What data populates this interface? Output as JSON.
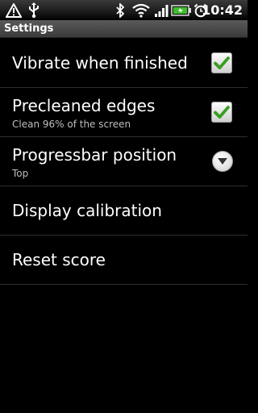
{
  "status_bar": {
    "time": "10:42",
    "icons": [
      "warning-icon",
      "usb-icon",
      "bluetooth-icon",
      "wifi-icon",
      "signal-icon",
      "battery-icon",
      "alarm-icon"
    ]
  },
  "title_bar": {
    "title": "Settings"
  },
  "settings": [
    {
      "title": "Vibrate when finished",
      "control": "checkbox",
      "checked": true
    },
    {
      "title": "Precleaned edges",
      "summary": "Clean 96% of the screen",
      "control": "checkbox",
      "checked": true
    },
    {
      "title": "Progressbar position",
      "summary": "Top",
      "control": "dropdown"
    },
    {
      "title": "Display calibration"
    },
    {
      "title": "Reset score"
    }
  ],
  "colors": {
    "check": "#3a9d23",
    "background": "#000000",
    "divider": "#2e2e2e"
  }
}
